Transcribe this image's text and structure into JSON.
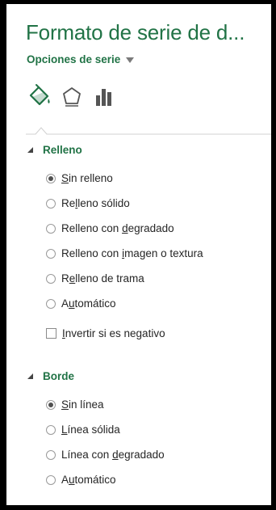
{
  "panel": {
    "title": "Formato de serie de d...",
    "subtitle": "Opciones de serie"
  },
  "icons": [
    {
      "name": "fill-line-icon",
      "selected": true
    },
    {
      "name": "effects-pentagon-icon",
      "selected": false
    },
    {
      "name": "series-options-bar-chart-icon",
      "selected": false
    }
  ],
  "sections": {
    "fill": {
      "title": "Relleno",
      "options": [
        {
          "pre": "",
          "key": "S",
          "post": "in relleno",
          "selected": true
        },
        {
          "pre": "Re",
          "key": "l",
          "post": "leno sólido",
          "selected": false
        },
        {
          "pre": "Relleno con ",
          "key": "d",
          "post": "egradado",
          "selected": false
        },
        {
          "pre": "Relleno con ",
          "key": "i",
          "post": "magen o textura",
          "selected": false
        },
        {
          "pre": "R",
          "key": "e",
          "post": "lleno de trama",
          "selected": false
        },
        {
          "pre": "A",
          "key": "u",
          "post": "tomático",
          "selected": false
        }
      ],
      "invert": {
        "pre": "",
        "key": "I",
        "post": "nvertir si es negativo",
        "checked": false
      }
    },
    "border": {
      "title": "Borde",
      "options": [
        {
          "pre": "",
          "key": "S",
          "post": "in línea",
          "selected": true
        },
        {
          "pre": "",
          "key": "L",
          "post": "ínea sólida",
          "selected": false
        },
        {
          "pre": "Línea con ",
          "key": "d",
          "post": "egradado",
          "selected": false
        },
        {
          "pre": "A",
          "key": "u",
          "post": "tomático",
          "selected": false
        }
      ]
    }
  },
  "colors": {
    "accent": "#217346",
    "text": "#262626"
  }
}
